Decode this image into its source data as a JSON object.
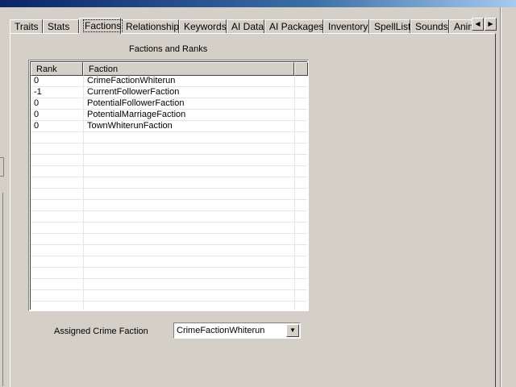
{
  "tabs": [
    {
      "label": "Traits"
    },
    {
      "label": "Stats"
    },
    {
      "label": "Factions",
      "active": true
    },
    {
      "label": "Relationships"
    },
    {
      "label": "Keywords"
    },
    {
      "label": "AI Data"
    },
    {
      "label": "AI Packages"
    },
    {
      "label": "Inventory"
    },
    {
      "label": "SpellList"
    },
    {
      "label": "Sounds"
    },
    {
      "label": "Anim"
    }
  ],
  "tab_scroll": {
    "left_icon": "left-arrow-icon",
    "right_icon": "right-arrow-icon",
    "left_glyph": "◀",
    "right_glyph": "▶"
  },
  "factions_section": {
    "title": "Factions and Ranks",
    "columns": [
      "Rank",
      "Faction"
    ],
    "rows": [
      {
        "rank": "0",
        "faction": "CrimeFactionWhiterun"
      },
      {
        "rank": "-1",
        "faction": "CurrentFollowerFaction"
      },
      {
        "rank": "0",
        "faction": "PotentialFollowerFaction"
      },
      {
        "rank": "0",
        "faction": "PotentialMarriageFaction"
      },
      {
        "rank": "0",
        "faction": "TownWhiterunFaction"
      }
    ]
  },
  "crime_faction": {
    "label": "Assigned Crime Faction",
    "selected": "CrimeFactionWhiterun",
    "dropdown_glyph": "▼"
  }
}
